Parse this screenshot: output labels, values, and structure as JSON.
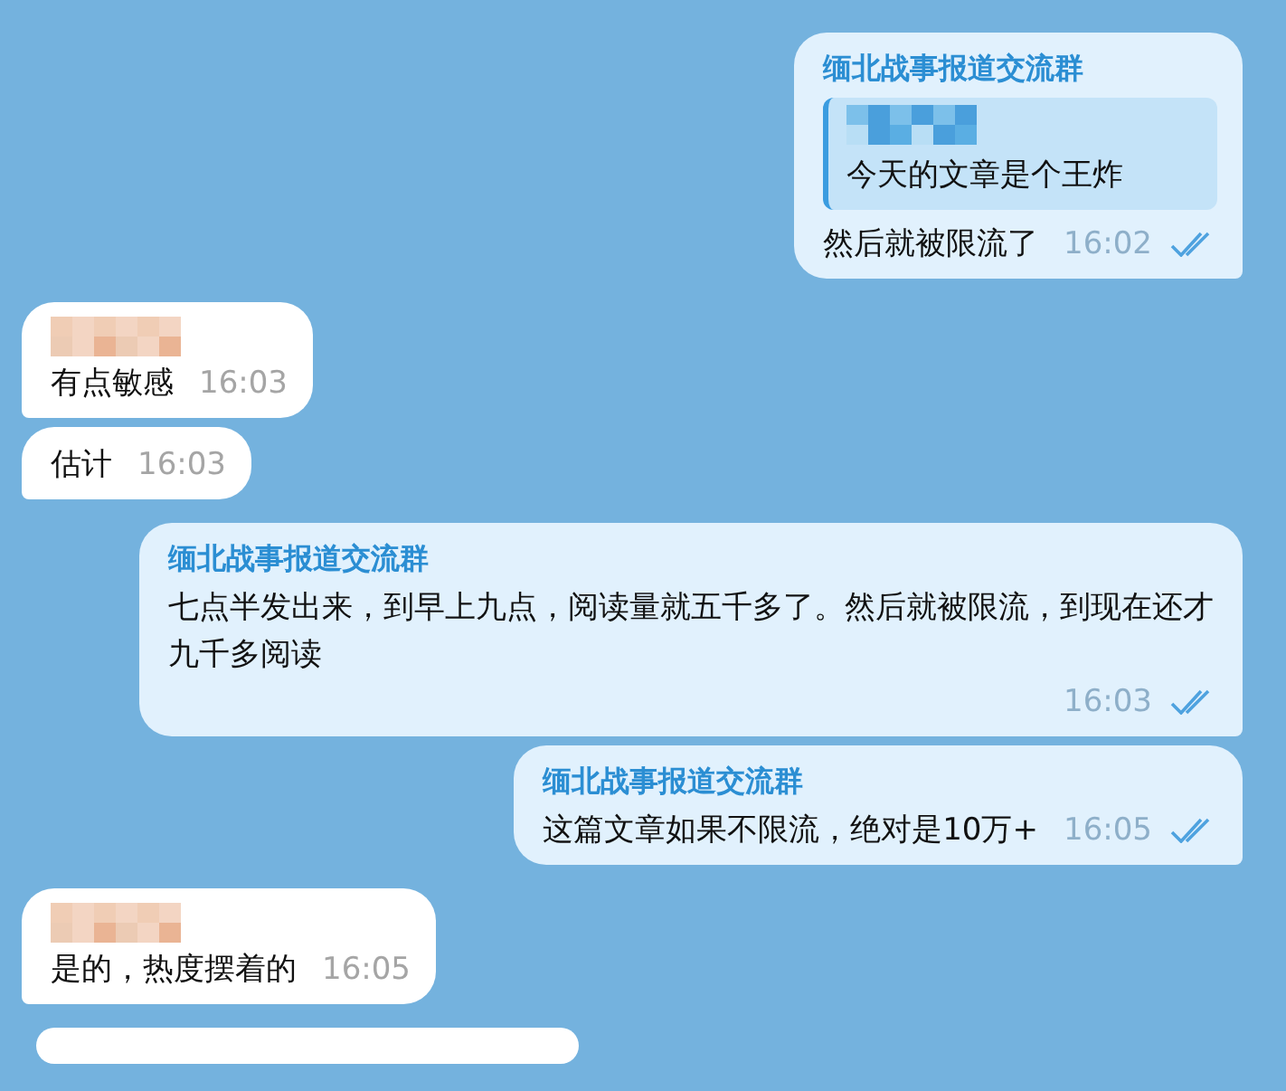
{
  "messages": [
    {
      "kind": "outgoing",
      "sender": "缅北战事报道交流群",
      "reply": {
        "sender_hidden": true,
        "text": "今天的文章是个王炸"
      },
      "text": "然后就被限流了",
      "time": "16:02",
      "read": true
    },
    {
      "kind": "incoming",
      "sender_hidden": true,
      "text": "有点敏感",
      "time": "16:03"
    },
    {
      "kind": "incoming",
      "sender_hidden": false,
      "text": "估计",
      "time": "16:03"
    },
    {
      "kind": "outgoing",
      "sender": "缅北战事报道交流群",
      "text": "七点半发出来，到早上九点，阅读量就五千多了。然后就被限流，到现在还才九千多阅读",
      "time": "16:03",
      "read": true
    },
    {
      "kind": "outgoing",
      "sender": "缅北战事报道交流群",
      "text": "这篇文章如果不限流，绝对是10万+",
      "time": "16:05",
      "read": true
    },
    {
      "kind": "incoming",
      "sender_hidden": true,
      "text": "是的，热度摆着的",
      "time": "16:05"
    },
    {
      "kind": "cut"
    }
  ]
}
